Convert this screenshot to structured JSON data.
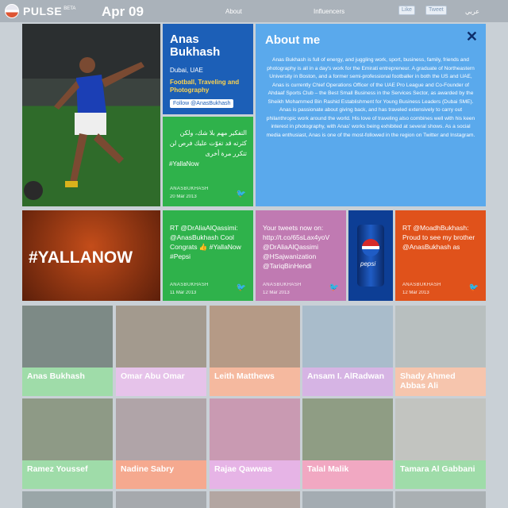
{
  "header": {
    "brand": "PULSE",
    "brand_sup": "BETA",
    "date": "Apr 09",
    "nav_about": "About",
    "nav_influencers": "Influencers",
    "like_label": "Like",
    "tweet_label": "Tweet",
    "language": "عربي"
  },
  "profile": {
    "name": "Anas Bukhash",
    "location": "Dubai, UAE",
    "tags": "Football, Traveling and Photography",
    "follow_label": "Follow @AnasBukhash"
  },
  "about": {
    "title": "About me",
    "close_icon": "close-icon",
    "text": "Anas Bukhash is full of energy, and juggling work, sport, business, family, friends and photography is all in a day's work for the Emirati entrepreneur. A graduate of Northeastern University in Boston, and a former semi-professional footballer in both the US and UAE, Anas is currently Chief Operations Officer of the UAE Pro League and Co-Founder of Ahdaaf Sports Club – the Best Small Business in the Services Sector, as awarded by the Sheikh Mohammed Bin Rashid Establishment for Young Business Leaders (Dubai SME). Anas is passionate about giving back, and has traveled extensively to carry out philanthropic work around the world. His love of traveling also combines well with his keen interest in photography, with Anas' works being exhibited at several shows. As a social media enthusiast, Anas is one of the most-followed in the region on Twitter and Instagram."
  },
  "tweets": [
    {
      "text": "التفكير مهم بلا شك، ولكن كثرته قد تفوّت عليك فرص لن تتكرر مرة أخرى",
      "tag": "#YallaNow",
      "handle": "ANASBUKHASH",
      "date": "20 Mar 2013",
      "color": "#2fb24b"
    },
    {
      "text": "RT @DrAliaAlQassimi: @AnasBukhash Cool Congrats 👍 #YallaNow #Pepsi",
      "handle": "ANASBUKHASH",
      "date": "11 Mar 2013",
      "color": "#2fb24b"
    },
    {
      "text": "Your tweets now on: http://t.co/65sLax4yoV @DrAliaAlQassimi @HSajwanization @TariqBinHendi",
      "handle": "ANASBUKHASH",
      "date": "12 Mar 2013",
      "color": "#c07ab2"
    },
    {
      "text": "RT @MoadhBukhash: Proud to see my brother @AnasBukhash as",
      "handle": "ANASBUKHASH",
      "date": "12 Mar 2013",
      "color": "#e0521b"
    }
  ],
  "promo": {
    "text": "#YALLANOW"
  },
  "pepsi_can": {
    "label": "pepsi"
  },
  "influencers": [
    {
      "name": "Anas Bukhash",
      "color": "#9fdca9"
    },
    {
      "name": "Omar Abu Omar",
      "color": "#e6c3ea"
    },
    {
      "name": "Leith Matthews",
      "color": "#f5b99f"
    },
    {
      "name": "Ansam I. AlRadwan",
      "color": "#d6b4e4"
    },
    {
      "name": "Shady Ahmed Abbas Ali",
      "color": "#f6c5ad"
    },
    {
      "name": "Ramez Youssef",
      "color": "#9fdca9"
    },
    {
      "name": "Nadine Sabry",
      "color": "#f5a98f"
    },
    {
      "name": "Rajae Qawwas",
      "color": "#e6b4e6"
    },
    {
      "name": "Talal Malik",
      "color": "#f1a8c2"
    },
    {
      "name": "Tamara Al Gabbani",
      "color": "#9fdca9"
    }
  ]
}
